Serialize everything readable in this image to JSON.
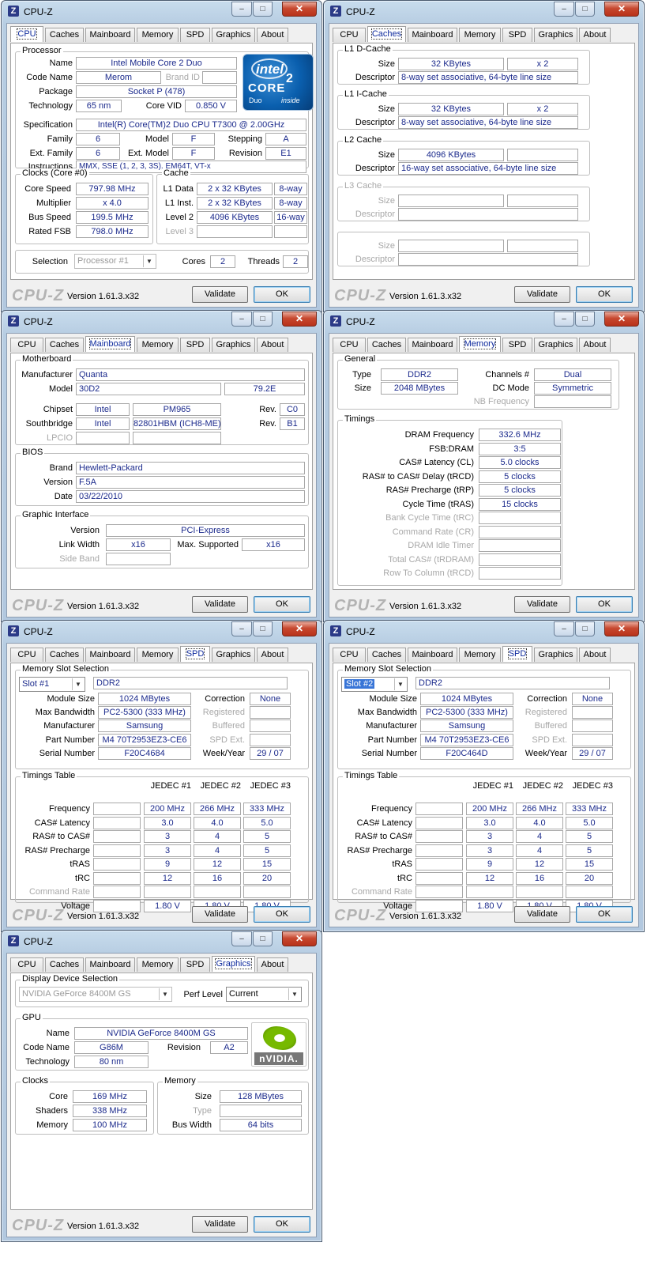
{
  "app_title": "CPU-Z",
  "footer": {
    "brand": "CPU-Z",
    "version": "Version 1.61.3.x32",
    "validate": "Validate",
    "ok": "OK"
  },
  "window_controls": {
    "min": "–",
    "max": "□",
    "close": "✕"
  },
  "tabs": [
    "CPU",
    "Caches",
    "Mainboard",
    "Memory",
    "SPD",
    "Graphics",
    "About"
  ],
  "cpu": {
    "group_processor": "Processor",
    "name_label": "Name",
    "name": "Intel Mobile Core 2 Duo",
    "code_name_label": "Code Name",
    "code_name": "Merom",
    "brand_id_label": "Brand ID",
    "brand_id": "",
    "package_label": "Package",
    "package": "Socket P (478)",
    "technology_label": "Technology",
    "technology": "65 nm",
    "core_vid_label": "Core VID",
    "core_vid": "0.850 V",
    "spec_label": "Specification",
    "spec": "Intel(R) Core(TM)2 Duo CPU     T7300  @ 2.00GHz",
    "family_label": "Family",
    "family": "6",
    "model_label": "Model",
    "model": "F",
    "stepping_label": "Stepping",
    "stepping": "A",
    "ext_family_label": "Ext. Family",
    "ext_family": "6",
    "ext_model_label": "Ext. Model",
    "ext_model": "F",
    "revision_label": "Revision",
    "revision": "E1",
    "instructions_label": "Instructions",
    "instructions": "MMX, SSE (1, 2, 3, 3S), EM64T, VT-x",
    "group_clocks": "Clocks (Core #0)",
    "core_speed_label": "Core Speed",
    "core_speed": "797.98 MHz",
    "multiplier_label": "Multiplier",
    "multiplier": "x 4.0",
    "bus_speed_label": "Bus Speed",
    "bus_speed": "199.5 MHz",
    "rated_fsb_label": "Rated FSB",
    "rated_fsb": "798.0 MHz",
    "group_cache": "Cache",
    "l1_data_label": "L1 Data",
    "l1_data": "2 x 32 KBytes",
    "l1_data_way": "8-way",
    "l1_inst_label": "L1 Inst.",
    "l1_inst": "2 x 32 KBytes",
    "l1_inst_way": "8-way",
    "level2_label": "Level 2",
    "level2": "4096 KBytes",
    "level2_way": "16-way",
    "level3_label": "Level 3",
    "selection_label": "Selection",
    "selection": "Processor #1",
    "cores_label": "Cores",
    "cores": "2",
    "threads_label": "Threads",
    "threads": "2",
    "logo": {
      "brand": "intel",
      "line": "CORE",
      "sup": "2",
      "sub": "Duo",
      "tag": "inside"
    }
  },
  "caches": {
    "size_label": "Size",
    "descriptor_label": "Descriptor",
    "l1d_title": "L1 D-Cache",
    "l1d_size": "32 KBytes",
    "l1d_mult": "x 2",
    "l1d_desc": "8-way set associative, 64-byte line size",
    "l1i_title": "L1 I-Cache",
    "l1i_size": "32 KBytes",
    "l1i_mult": "x 2",
    "l1i_desc": "8-way set associative, 64-byte line size",
    "l2_title": "L2 Cache",
    "l2_size": "4096 KBytes",
    "l2_desc": "16-way set associative, 64-byte line size",
    "l3_title": "L3 Cache"
  },
  "mainboard": {
    "group_motherboard": "Motherboard",
    "manufacturer_label": "Manufacturer",
    "manufacturer": "Quanta",
    "model_label": "Model",
    "model": "30D2",
    "model_rev": "79.2E",
    "chipset_label": "Chipset",
    "chipset_vendor": "Intel",
    "chipset": "PM965",
    "rev_label": "Rev.",
    "chipset_rev": "C0",
    "southbridge_label": "Southbridge",
    "sb_vendor": "Intel",
    "southbridge": "82801HBM (ICH8-ME)",
    "sb_rev": "B1",
    "lpcio_label": "LPCIO",
    "group_bios": "BIOS",
    "brand_label": "Brand",
    "bios_brand": "Hewlett-Packard",
    "version_label": "Version",
    "bios_version": "F.5A",
    "date_label": "Date",
    "bios_date": "03/22/2010",
    "group_graphic": "Graphic Interface",
    "gi_version_label": "Version",
    "gi_version": "PCI-Express",
    "link_width_label": "Link Width",
    "link_width": "x16",
    "max_supported_label": "Max. Supported",
    "max_supported": "x16",
    "side_band_label": "Side Band"
  },
  "memory": {
    "group_general": "General",
    "type_label": "Type",
    "type": "DDR2",
    "size_label": "Size",
    "size": "2048 MBytes",
    "channels_label": "Channels #",
    "channels": "Dual",
    "dc_mode_label": "DC Mode",
    "dc_mode": "Symmetric",
    "nb_freq_label": "NB Frequency",
    "group_timings": "Timings",
    "timings": [
      {
        "label": "DRAM Frequency",
        "value": "332.6 MHz",
        "enabled": true
      },
      {
        "label": "FSB:DRAM",
        "value": "3:5",
        "enabled": true
      },
      {
        "label": "CAS# Latency (CL)",
        "value": "5.0 clocks",
        "enabled": true
      },
      {
        "label": "RAS# to CAS# Delay (tRCD)",
        "value": "5 clocks",
        "enabled": true
      },
      {
        "label": "RAS# Precharge (tRP)",
        "value": "5 clocks",
        "enabled": true
      },
      {
        "label": "Cycle Time (tRAS)",
        "value": "15 clocks",
        "enabled": true
      },
      {
        "label": "Bank Cycle Time (tRC)",
        "value": "",
        "enabled": false
      },
      {
        "label": "Command Rate (CR)",
        "value": "",
        "enabled": false
      },
      {
        "label": "DRAM Idle Timer",
        "value": "",
        "enabled": false
      },
      {
        "label": "Total CAS# (tRDRAM)",
        "value": "",
        "enabled": false
      },
      {
        "label": "Row To Column (tRCD)",
        "value": "",
        "enabled": false
      }
    ]
  },
  "spd_labels": {
    "group_slot": "Memory Slot Selection",
    "module_size": "Module Size",
    "max_bandwidth": "Max Bandwidth",
    "manufacturer": "Manufacturer",
    "part_number": "Part Number",
    "serial_number": "Serial Number",
    "correction": "Correction",
    "registered": "Registered",
    "buffered": "Buffered",
    "spd_ext": "SPD Ext.",
    "week_year": "Week/Year",
    "group_timings": "Timings Table",
    "jedec1": "JEDEC #1",
    "jedec2": "JEDEC #2",
    "jedec3": "JEDEC #3",
    "row_labels": [
      "Frequency",
      "CAS# Latency",
      "RAS# to CAS#",
      "RAS# Precharge",
      "tRAS",
      "tRC",
      "Command Rate",
      "Voltage"
    ]
  },
  "spd1": {
    "slot": "Slot #1",
    "type": "DDR2",
    "module_size": "1024 MBytes",
    "max_bandwidth": "PC2-5300 (333 MHz)",
    "manufacturer": "Samsung",
    "part_number": "M4 70T2953EZ3-CE6",
    "serial_number": "F20C4684",
    "correction": "None",
    "week_year": "29 / 07",
    "rows": [
      [
        "200 MHz",
        "266 MHz",
        "333 MHz"
      ],
      [
        "3.0",
        "4.0",
        "5.0"
      ],
      [
        "3",
        "4",
        "5"
      ],
      [
        "3",
        "4",
        "5"
      ],
      [
        "9",
        "12",
        "15"
      ],
      [
        "12",
        "16",
        "20"
      ],
      [
        "",
        "",
        ""
      ],
      [
        "1.80 V",
        "1.80 V",
        "1.80 V"
      ]
    ]
  },
  "spd2": {
    "slot": "Slot #2",
    "type": "DDR2",
    "module_size": "1024 MBytes",
    "max_bandwidth": "PC2-5300 (333 MHz)",
    "manufacturer": "Samsung",
    "part_number": "M4 70T2953EZ3-CE6",
    "serial_number": "F20C464D",
    "correction": "None",
    "week_year": "29 / 07",
    "rows": [
      [
        "200 MHz",
        "266 MHz",
        "333 MHz"
      ],
      [
        "3.0",
        "4.0",
        "5.0"
      ],
      [
        "3",
        "4",
        "5"
      ],
      [
        "3",
        "4",
        "5"
      ],
      [
        "9",
        "12",
        "15"
      ],
      [
        "12",
        "16",
        "20"
      ],
      [
        "",
        "",
        ""
      ],
      [
        "1.80 V",
        "1.80 V",
        "1.80 V"
      ]
    ]
  },
  "graphics": {
    "group_display": "Display Device Selection",
    "device": "NVIDIA GeForce 8400M GS",
    "perf_level_label": "Perf Level",
    "perf_level": "Current",
    "group_gpu": "GPU",
    "name_label": "Name",
    "name": "NVIDIA GeForce 8400M GS",
    "code_name_label": "Code Name",
    "code_name": "G86M",
    "revision_label": "Revision",
    "revision": "A2",
    "technology_label": "Technology",
    "technology": "80 nm",
    "group_clocks": "Clocks",
    "core_label": "Core",
    "core": "169 MHz",
    "shaders_label": "Shaders",
    "shaders": "338 MHz",
    "memory_label": "Memory",
    "memory_clock": "100 MHz",
    "group_memory": "Memory",
    "size_label": "Size",
    "size": "128 MBytes",
    "type_label": "Type",
    "type": "",
    "bus_width_label": "Bus Width",
    "bus_width": "64 bits",
    "logo_text": "nVIDIA."
  },
  "colors": {
    "field_text": "#1b2a8c",
    "intel_blue": "#0a5fae",
    "nvidia_green": "#76b900"
  }
}
